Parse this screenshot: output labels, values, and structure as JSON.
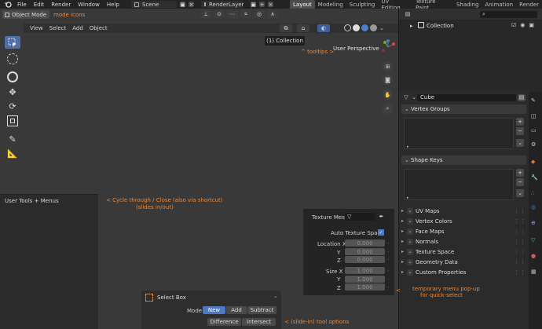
{
  "topbar": {
    "menus": [
      "File",
      "Edit",
      "Render",
      "Window",
      "Help"
    ],
    "scene": "Scene",
    "render_layer": "RenderLayer",
    "workspaces": [
      "Layout",
      "Modeling",
      "Sculpting",
      "UV Editing",
      "Texture Paint",
      "Shading",
      "Animation",
      "Render"
    ],
    "active_workspace": "Layout"
  },
  "viewport": {
    "mode": "Object Mode",
    "mode_note": "mode icons",
    "header_menus": [
      "View",
      "Select",
      "Add",
      "Object"
    ],
    "collection_tooltip": "(1) Collection",
    "perspective": "User Perspective",
    "tooltips_note": "^ tooltips >"
  },
  "left_panel": {
    "label": "User Tools + Menus",
    "note_line1": "<  Cycle through / Close  (also via shortcut)",
    "note_line2": "(slides in/out)"
  },
  "texture_popup": {
    "texture_mesh_label": "Texture Mesh",
    "auto_texture_space": "Auto Texture Space",
    "location_label": "Location X",
    "size_label": "Size X",
    "y": "Y",
    "z": "Z",
    "location_values": [
      "0.000",
      "0.000",
      "0.000"
    ],
    "size_values": [
      "1.000",
      "1.000",
      "1.000"
    ]
  },
  "operator_panel": {
    "title": "Select Box",
    "mode_label": "Mode",
    "buttons": [
      "New",
      "Add",
      "Subtract",
      "Difference",
      "Intersect"
    ],
    "active": "New",
    "note": "<  (slide-in)  tool options"
  },
  "outliner": {
    "item": "Collection"
  },
  "properties": {
    "object_name": "Cube",
    "vertex_groups": "Vertex Groups",
    "shape_keys": "Shape Keys",
    "sections": [
      "UV Maps",
      "Vertex Colors",
      "Face Maps",
      "Normals",
      "Texture Space",
      "Geometry Data",
      "Custom Properties"
    ],
    "note_line1": "temporary menu pop-up",
    "note_line2": "for quick-select",
    "note_arrow": "<"
  }
}
